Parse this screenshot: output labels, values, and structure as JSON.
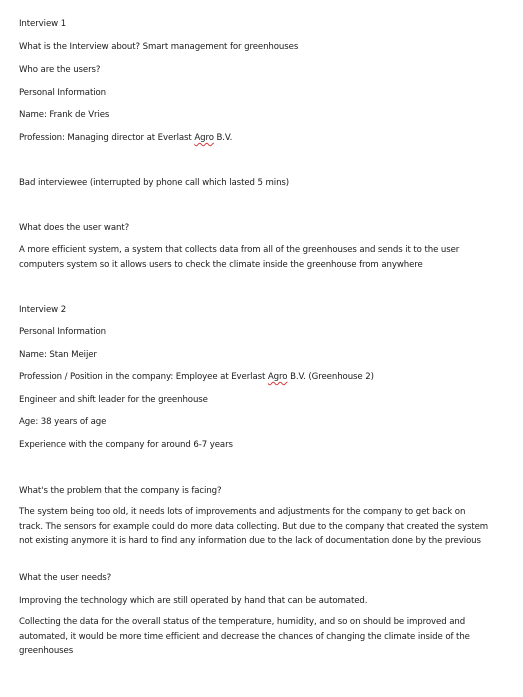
{
  "doc": {
    "i1_heading": "Interview 1",
    "i1_about": "What is the Interview about? Smart management for greenhouses",
    "i1_users_q": "Who are the users?",
    "i1_personal": "Personal Information",
    "i1_name": "Name: Frank de Vries",
    "i1_prof_a": "Profession: Managing director at Everlast ",
    "i1_prof_agro": "Agro",
    "i1_prof_b": " B.V.",
    "i1_bad": "Bad interviewee (interrupted by phone call which lasted 5 mins)",
    "i1_want_q": "What does the user want?",
    "i1_want_a": " A more efficient system, a system that collects data from all of the greenhouses and sends it to the user computers system so it allows users to check the climate inside the greenhouse from anywhere",
    "i2_heading": "Interview 2",
    "i2_personal": "Personal Information",
    "i2_name": "Name: Stan Meijer",
    "i2_prof_a": "Profession / Position in the company: Employee at Everlast ",
    "i2_prof_agro": "Agro",
    "i2_prof_b": " B.V. (Greenhouse 2)",
    "i2_engineer": "Engineer and shift leader for the greenhouse",
    "i2_age": "Age: 38 years of age",
    "i2_experience": "Experience with the company for around 6-7 years",
    "problem_q": "What's the problem that the company is facing?",
    "problem_a": "The system being too old, it needs lots of improvements and adjustments for the company to get back on track. The sensors for example could do more data collecting. But due to the company that created the system not existing anymore it is hard to find any information due to the lack of documentation done by the previous",
    "needs_q": "What the user needs?",
    "needs_a1": "Improving the technology which are still operated by hand that can be automated.",
    "needs_a2": "Collecting the data for the overall status of the temperature, humidity, and so on should be improved and automated, it would be more time efficient and decrease the chances of changing the climate inside of the greenhouses"
  }
}
